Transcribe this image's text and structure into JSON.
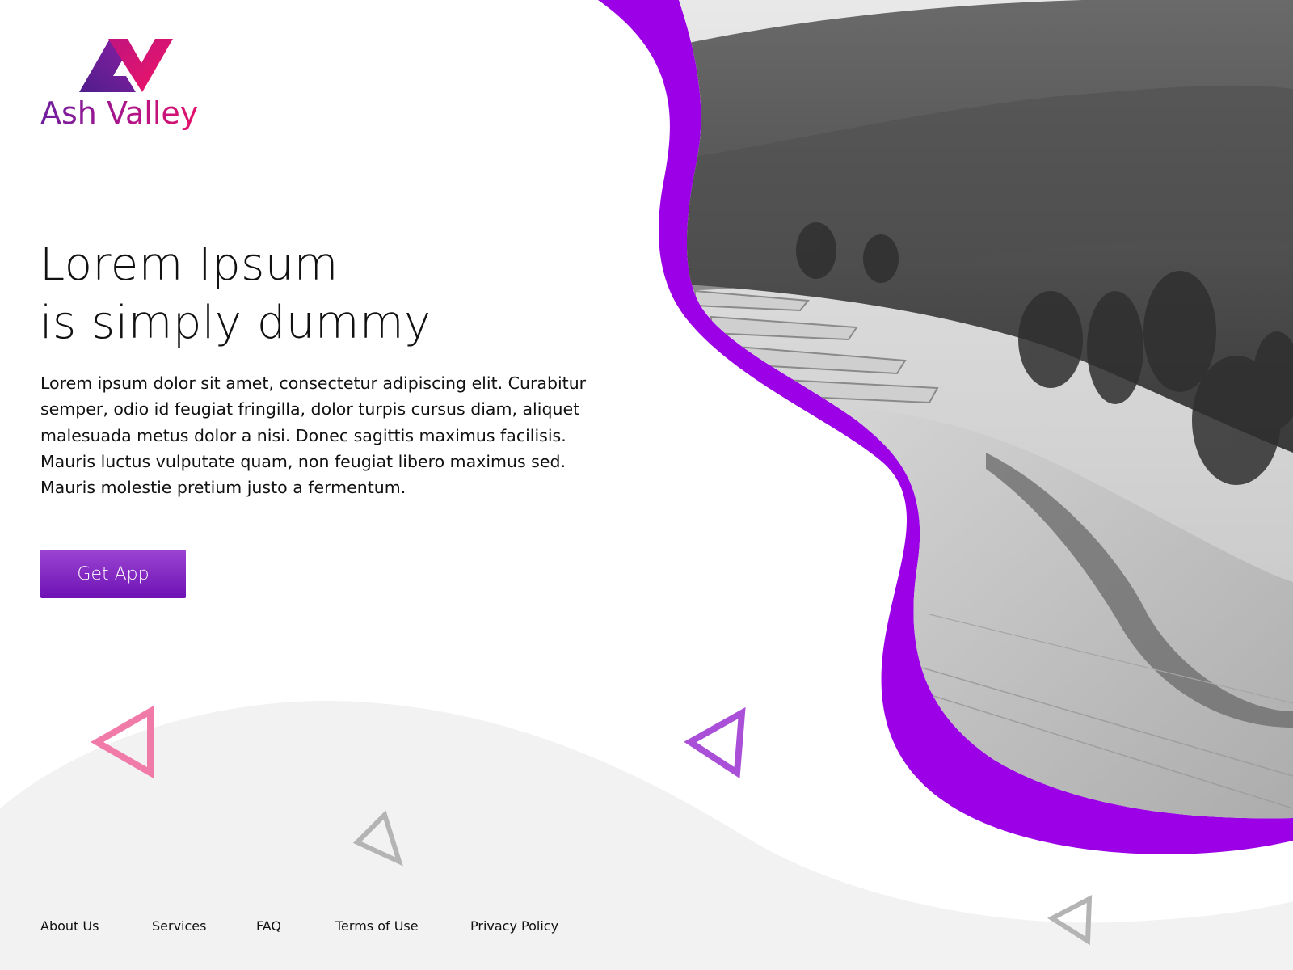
{
  "brand": {
    "name": "Ash Valley",
    "logo_icon": "av-monogram-icon",
    "colors": {
      "purple": "#6d1f9e",
      "magenta": "#e3116a"
    }
  },
  "hero": {
    "title_line1": "Lorem Ipsum",
    "title_line2": "is simply dummy",
    "body": "Lorem ipsum dolor sit amet, consectetur adipiscing elit. Curabitur semper, odio id feugiat fringilla, dolor turpis cursus diam, aliquet malesuada metus dolor a nisi. Donec sagittis maximus facilisis. Mauris luctus vulputate quam, non feugiat libero maximus sed. Mauris molestie pretium justo a fermentum.",
    "cta_label": "Get App"
  },
  "footer": {
    "links": [
      "About Us",
      "Services",
      "FAQ",
      "Terms of Use",
      "Privacy Policy"
    ]
  },
  "theme": {
    "accent": "#9b00e6",
    "button_gradient": [
      "#9b44d2",
      "#6e12b4"
    ],
    "wave_gray": "#f2f2f2",
    "triangle_pink": "#f07aa8",
    "triangle_purple": "#a94fd8",
    "triangle_gray": "#b4b4b4"
  },
  "decorations": {
    "hero_image": "mountain-valley-photo",
    "triangles": [
      "triangle-outline-icon",
      "triangle-outline-icon",
      "triangle-outline-icon",
      "triangle-outline-icon"
    ]
  }
}
